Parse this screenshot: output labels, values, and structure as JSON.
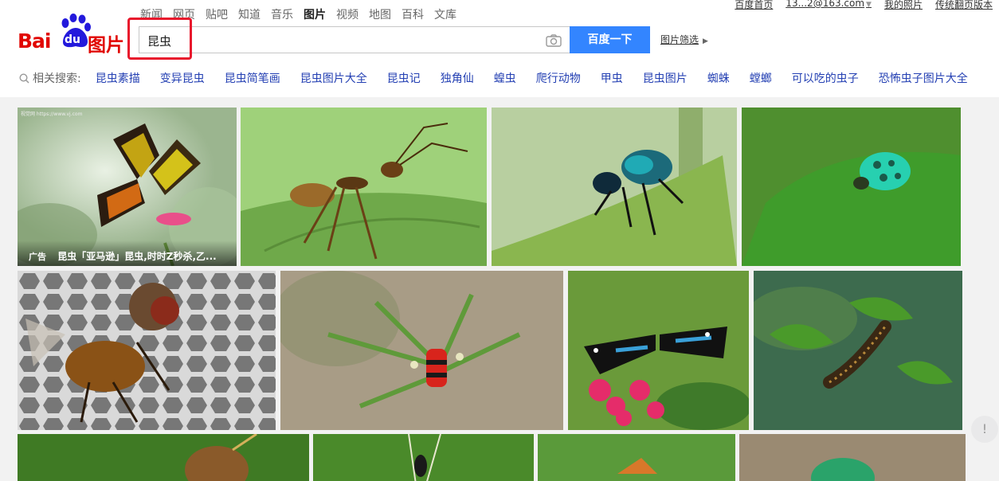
{
  "top_right": {
    "home": "百度首页",
    "account": "13...2@163.com",
    "mine": "我的照片",
    "classic": "传统翻页版本"
  },
  "logo": {
    "left": "Bai",
    "du": "du",
    "right": "图片"
  },
  "nav": [
    "新闻",
    "网页",
    "贴吧",
    "知道",
    "音乐",
    "图片",
    "视频",
    "地图",
    "百科",
    "文库"
  ],
  "nav_active": "图片",
  "search": {
    "value": "昆虫",
    "button": "百度一下",
    "filter": "图片筛选"
  },
  "related": {
    "label": "相关搜索:",
    "tags": [
      "昆虫素描",
      "变异昆虫",
      "昆虫简笔画",
      "昆虫图片大全",
      "昆虫记",
      "独角仙",
      "蝗虫",
      "爬行动物",
      "甲虫",
      "昆虫图片",
      "蜘蛛",
      "螳螂",
      "可以吃的虫子",
      "恐怖虫子图片大全"
    ]
  },
  "results": {
    "ad_badge": "广告",
    "ad_caption": "昆虫「亚马逊」昆虫,时时Z秒杀,乙...",
    "watermark": "视觉网 https://www.vj.com"
  },
  "help": "!",
  "colors": {
    "brand_red": "#e10601",
    "brand_blue": "#2319dc",
    "button_blue": "#3385ff",
    "link_blue": "#2440b3",
    "highlight": "#e8172c"
  }
}
